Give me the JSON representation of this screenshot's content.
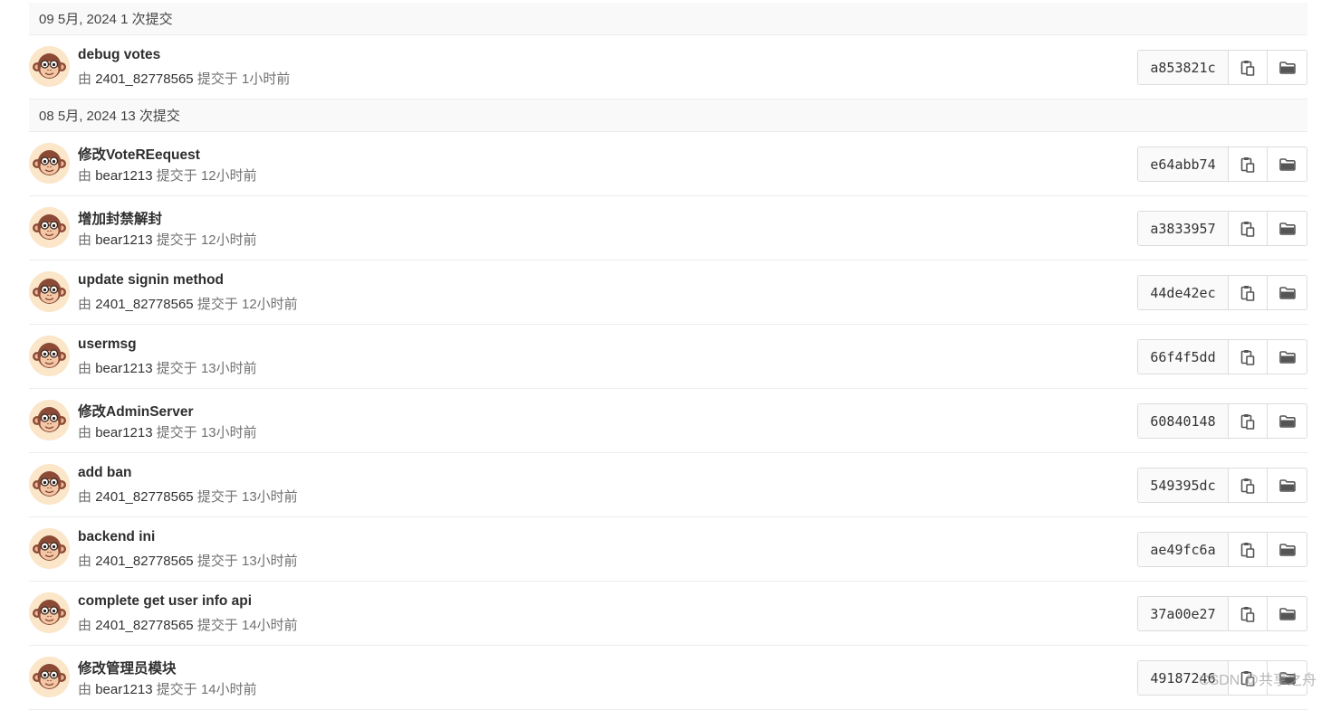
{
  "colors": {
    "day_header_bg": "#f9f9f9",
    "border": "#ececec",
    "avatar_bg": "#fbe6c9",
    "avatar_face": "#8b4a35",
    "meta_text": "#707070"
  },
  "icons": {
    "avatar": "monkey-avatar-icon",
    "copy": "clipboard-icon",
    "browse": "folder-icon"
  },
  "groups": [
    {
      "header": "09 5月, 2024 1 次提交",
      "commits": [
        {
          "title": "debug votes",
          "by": "由",
          "author": "2401_82778565",
          "action": "提交于",
          "time": "1小时前",
          "sha": "a853821c"
        }
      ]
    },
    {
      "header": "08 5月, 2024 13 次提交",
      "commits": [
        {
          "title": "修改VoteREequest",
          "by": "由",
          "author": "bear1213",
          "action": "提交于",
          "time": "12小时前",
          "sha": "e64abb74"
        },
        {
          "title": "增加封禁解封",
          "by": "由",
          "author": "bear1213",
          "action": "提交于",
          "time": "12小时前",
          "sha": "a3833957"
        },
        {
          "title": "update signin method",
          "by": "由",
          "author": "2401_82778565",
          "action": "提交于",
          "time": "12小时前",
          "sha": "44de42ec"
        },
        {
          "title": "usermsg",
          "by": "由",
          "author": "bear1213",
          "action": "提交于",
          "time": "13小时前",
          "sha": "66f4f5dd"
        },
        {
          "title": "修改AdminServer",
          "by": "由",
          "author": "bear1213",
          "action": "提交于",
          "time": "13小时前",
          "sha": "60840148"
        },
        {
          "title": "add ban",
          "by": "由",
          "author": "2401_82778565",
          "action": "提交于",
          "time": "13小时前",
          "sha": "549395dc"
        },
        {
          "title": "backend ini",
          "by": "由",
          "author": "2401_82778565",
          "action": "提交于",
          "time": "13小时前",
          "sha": "ae49fc6a"
        },
        {
          "title": "complete get user info api",
          "by": "由",
          "author": "2401_82778565",
          "action": "提交于",
          "time": "14小时前",
          "sha": "37a00e27"
        },
        {
          "title": "修改管理员模块",
          "by": "由",
          "author": "bear1213",
          "action": "提交于",
          "time": "14小时前",
          "sha": "49187246"
        }
      ]
    }
  ],
  "watermark": "CSDN @共享之舟"
}
